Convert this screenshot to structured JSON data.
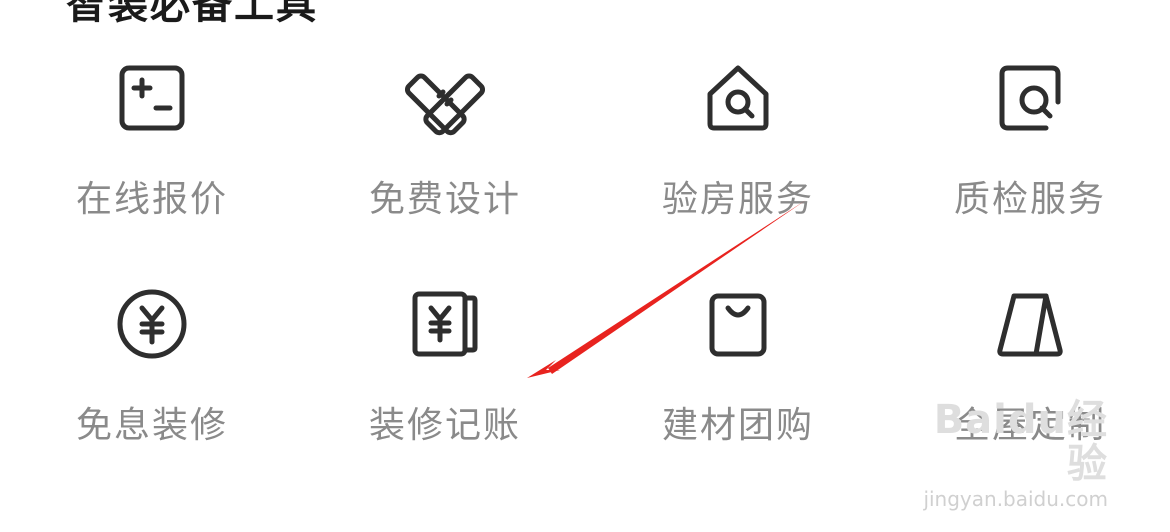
{
  "section": {
    "title": "智装必备工具"
  },
  "tools": [
    {
      "label": "在线报价",
      "icon": "calculator-icon"
    },
    {
      "label": "免费设计",
      "icon": "ruler-design-icon"
    },
    {
      "label": "验房服务",
      "icon": "house-inspect-icon"
    },
    {
      "label": "质检服务",
      "icon": "quality-check-icon"
    },
    {
      "label": "免息装修",
      "icon": "yuan-coin-icon"
    },
    {
      "label": "装修记账",
      "icon": "ledger-icon"
    },
    {
      "label": "建材团购",
      "icon": "shopping-bag-icon"
    },
    {
      "label": "全屋定制",
      "icon": "wardrobe-icon"
    }
  ],
  "colors": {
    "icon_stroke": "#2e2e2e",
    "label_text": "#8a8a8a",
    "annotation_arrow": "#e8231f",
    "background": "#ffffff"
  },
  "watermark": {
    "logo": "Baidu经验",
    "url": "jingyan.baidu.com"
  }
}
